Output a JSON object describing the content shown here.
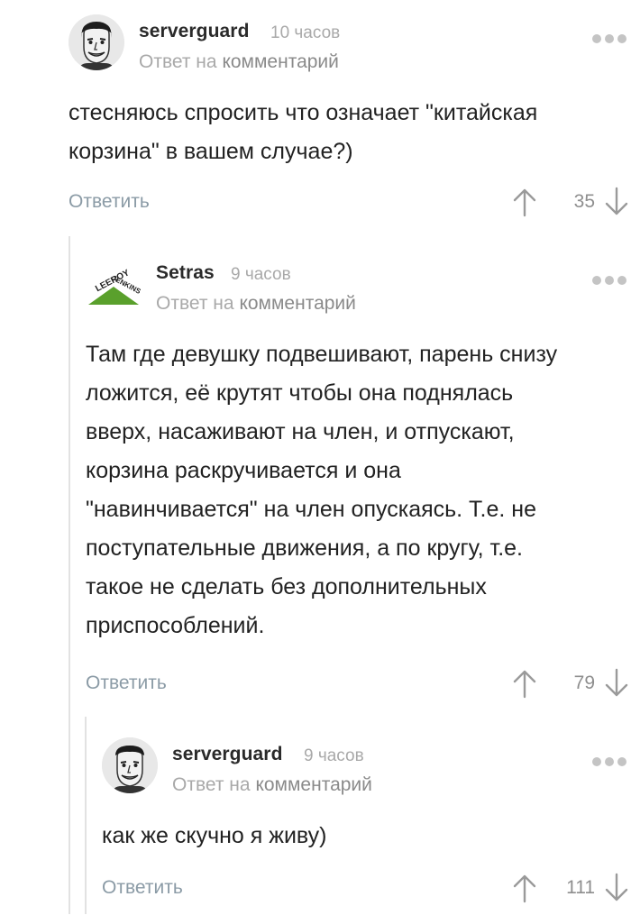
{
  "comments": [
    {
      "author": "serverguard",
      "time": "10 часов",
      "reply_prefix": "Ответ на",
      "reply_link": "комментарий",
      "lines": [
        "стесняюсь спросить что означает \"китайская",
        "корзина\" в вашем случае?)"
      ],
      "reply_label": "Ответить",
      "score": "35",
      "avatar": "man-face-avatar"
    },
    {
      "author": "Setras",
      "time": "9 часов",
      "reply_prefix": "Ответ на",
      "reply_link": "комментарий",
      "lines": [
        "Там где девушку подвешивают, парень снизу",
        "ложится, её крутят чтобы она поднялась",
        "вверх, насаживают на член, и отпускают,",
        "корзина раскручивается и она",
        "\"навинчивается\" на член опускаясь. Т.е. не",
        "поступательные движения, а по кругу, т.е.",
        "такое не сделать без дополнительных",
        "приспособлений."
      ],
      "reply_label": "Ответить",
      "score": "79",
      "avatar": "leeroy-jenkins-logo",
      "logo_text": "LEEROY JENKINS"
    },
    {
      "author": "serverguard",
      "time": "9 часов",
      "reply_prefix": "Ответ на",
      "reply_link": "комментарий",
      "lines": [
        "как же скучно я живу)"
      ],
      "reply_label": "Ответить",
      "score": "111",
      "avatar": "man-face-avatar"
    }
  ],
  "colors": {
    "reply_button": "#8b9ba6",
    "muted": "#a9a9a9",
    "thread_line": "#e2e2e2",
    "logo_green": "#5aa02c"
  }
}
